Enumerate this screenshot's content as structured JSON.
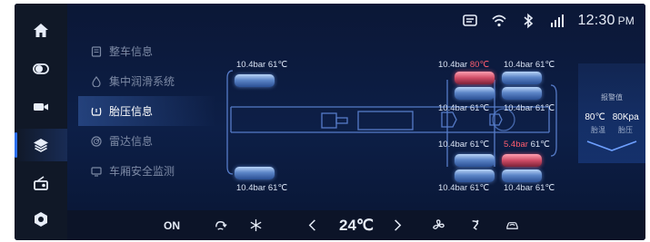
{
  "rail": {
    "items": [
      {
        "name": "home-icon"
      },
      {
        "name": "toggle-icon"
      },
      {
        "name": "camera-icon"
      },
      {
        "name": "layers-icon",
        "active": true
      },
      {
        "name": "radio-icon"
      },
      {
        "name": "settings-icon"
      }
    ]
  },
  "status": {
    "time": "12:30",
    "ampm": "PM",
    "icons": [
      "message-icon",
      "wifi-icon",
      "bluetooth-icon",
      "signal-icon"
    ]
  },
  "submenu": {
    "items": [
      {
        "label": "整车信息",
        "icon": "document-icon"
      },
      {
        "label": "集中润滑系统",
        "icon": "drop-icon"
      },
      {
        "label": "胎压信息",
        "icon": "tire-pressure-icon",
        "active": true
      },
      {
        "label": "雷达信息",
        "icon": "radar-icon"
      },
      {
        "label": "车厢安全监测",
        "icon": "monitor-icon"
      }
    ]
  },
  "tires": {
    "front_left": {
      "pressure": "10.4bar",
      "temp": "61℃"
    },
    "front_right": {
      "pressure": "10.4bar",
      "temp": "61℃"
    },
    "r1_outer_left": {
      "pressure": "10.4bar",
      "temp": "80℃",
      "alert": "temp"
    },
    "r1_outer_right": {
      "pressure": "10.4bar",
      "temp": "61℃"
    },
    "r1_inner_left": {
      "pressure": "10.4bar",
      "temp": "61℃"
    },
    "r1_inner_right": {
      "pressure": "10.4bar",
      "temp": "61℃"
    },
    "r2_inner_left": {
      "pressure": "10.4bar",
      "temp": "61℃"
    },
    "r2_inner_right": {
      "pressure": "5.4bar",
      "temp": "61℃",
      "alert": "pressure"
    },
    "r2_outer_left": {
      "pressure": "10.4bar",
      "temp": "61℃"
    },
    "r2_outer_right": {
      "pressure": "10.4bar",
      "temp": "61℃"
    }
  },
  "alarm": {
    "title": "报警值",
    "temp_value": "80℃",
    "pressure_value": "80Kpa",
    "temp_caption": "胎温",
    "pressure_caption": "胎压"
  },
  "climate": {
    "power": "ON",
    "temperature": "24℃",
    "icons": [
      "recirculation-icon",
      "snowflake-icon",
      "chevron-left-icon",
      "chevron-right-icon",
      "fan-icon",
      "seat-airflow-icon",
      "car-airflow-icon"
    ]
  },
  "colors": {
    "background": "#0a1430",
    "accent": "#2b6ff0",
    "alert": "#ff5d6e"
  }
}
